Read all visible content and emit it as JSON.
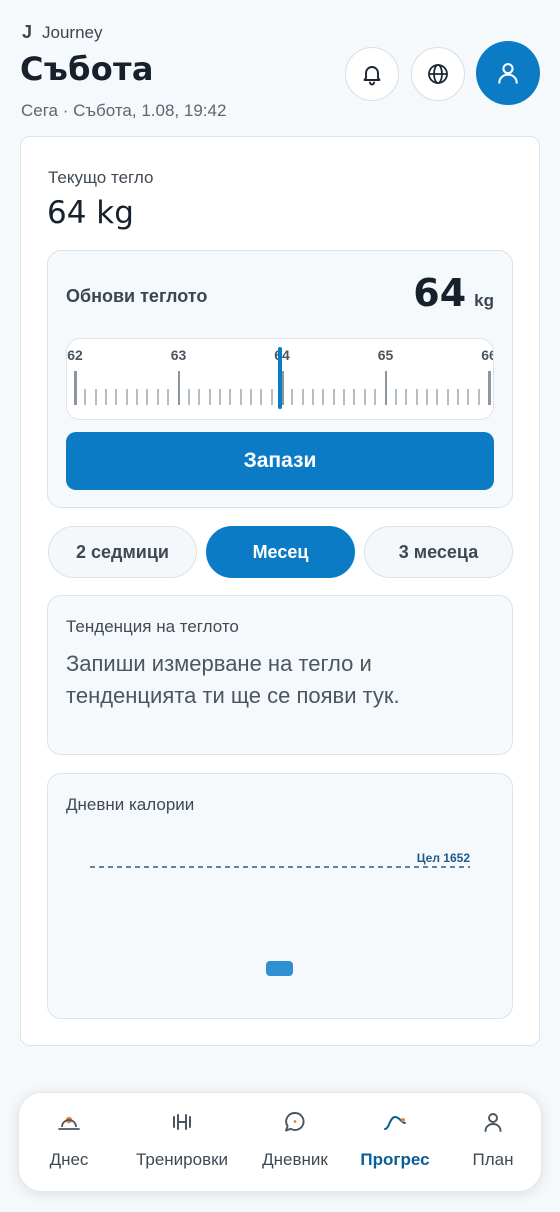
{
  "header": {
    "app_name": "Journey",
    "app_logo": "J",
    "title": "Събота",
    "subtitle": "Сега · Събота, 1.08, 19:42",
    "icons": [
      "bell-icon",
      "globe-icon",
      "user-icon"
    ]
  },
  "current_weight": {
    "label": "Текущо тегло",
    "value": "64 kg"
  },
  "update_weight": {
    "title": "Обнови теглото",
    "value": "64",
    "unit": "kg",
    "ruler": {
      "labels": [
        "62",
        "63",
        "64",
        "65",
        "66"
      ],
      "selected": 64
    },
    "save_label": "Запази"
  },
  "periods": {
    "options": [
      "2 седмици",
      "Месец",
      "3 месеца"
    ],
    "selected": "Месец"
  },
  "trend": {
    "title": "Тенденция на теглото",
    "message": "Запиши измерване на тегло и тенденцията ти ще се появи тук."
  },
  "calories": {
    "title": "Дневни калории",
    "goal_label": "Цел 1652",
    "goal": 1652
  },
  "colors": {
    "accent": "#0b7bc6",
    "nav_active": "#0a5f98"
  },
  "nav": {
    "items": [
      {
        "label": "Днес",
        "icon": "today-icon"
      },
      {
        "label": "Тренировки",
        "icon": "dumbbell-icon"
      },
      {
        "label": "Дневник",
        "icon": "chat-icon"
      },
      {
        "label": "Прогрес",
        "icon": "progress-icon"
      },
      {
        "label": "План",
        "icon": "user-icon"
      }
    ],
    "active": "Прогрес"
  }
}
